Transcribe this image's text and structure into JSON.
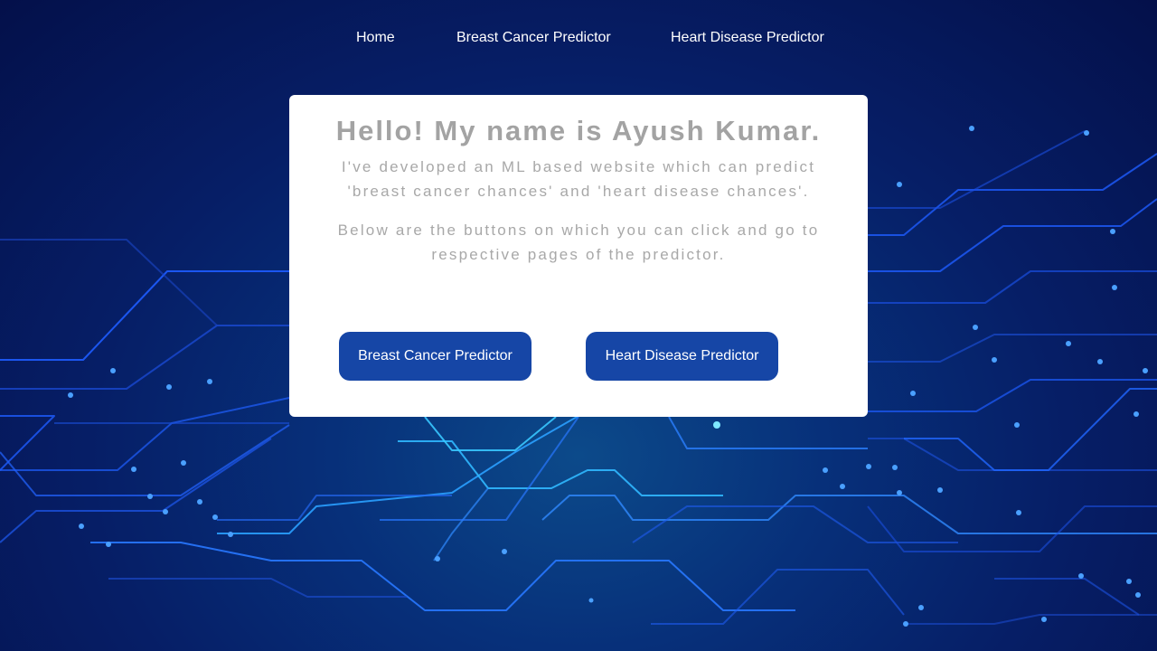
{
  "nav": {
    "home_label": "Home",
    "breast_cancer_label": "Breast Cancer Predictor",
    "heart_disease_label": "Heart Disease Predictor"
  },
  "card": {
    "title": "Hello! My name is Ayush Kumar.",
    "paragraph_1": "I've developed an ML based website which can predict 'breast cancer chances' and 'heart disease chances'.",
    "paragraph_2": "Below are the buttons on which you can click and go to respective pages of the predictor.",
    "breast_cancer_button": "Breast Cancer Predictor",
    "heart_disease_button": "Heart Disease Predictor"
  },
  "colors": {
    "button_bg": "#1646a6",
    "background_dark": "#04104a",
    "circuit_line": "#1e63ff",
    "circuit_glow": "#35c8ff"
  }
}
